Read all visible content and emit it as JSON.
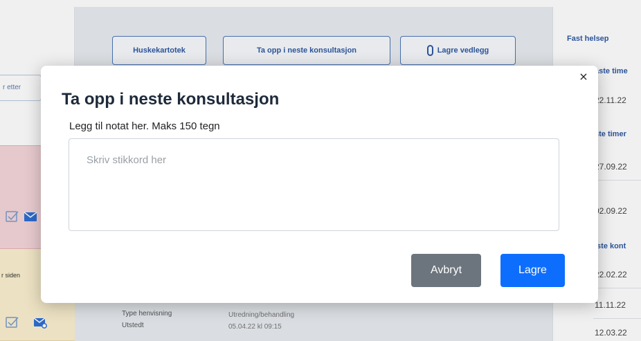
{
  "toolbar": {
    "huskekartotek_label": "Huskekartotek",
    "neste_konsultasjon_label": "Ta opp i neste konsultasjon",
    "lagre_vedlegg_label": "Lagre vedlegg"
  },
  "left_column": {
    "filter_text": "r etter",
    "siden_text": "r siden"
  },
  "info": {
    "rows": [
      {
        "label": "Type henvisning",
        "value": "Utredning/behandling"
      },
      {
        "label": "Utstedt",
        "value": "05.04.22 kl 09:15"
      }
    ]
  },
  "right_column": {
    "title": "Fast helsep",
    "sections": [
      {
        "heading": "aste time",
        "dates": [
          "22.11.22"
        ]
      },
      {
        "heading": "ste timer",
        "dates": [
          "27.09.22",
          "02.09.22"
        ]
      },
      {
        "heading": "iste kont",
        "dates": [
          "22.02.22",
          "11.11.22",
          "12.03.22"
        ]
      }
    ]
  },
  "modal": {
    "title": "Ta opp i neste konsultasjon",
    "subtitle": "Legg til notat her. Maks 150 tegn",
    "textarea_placeholder": "Skriv stikkord her",
    "textarea_value": "",
    "close_glyph": "×",
    "cancel_label": "Avbryt",
    "save_label": "Lagre"
  },
  "colors": {
    "primary": "#0d6efd",
    "secondary": "#6c757d",
    "link_blue": "#2f5aa3",
    "alert_pink": "#f5d6da",
    "warning_yellow": "#fbf0cf"
  }
}
